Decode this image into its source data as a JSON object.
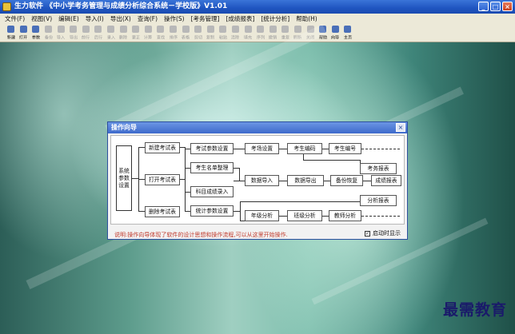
{
  "window": {
    "title": "生力软件 《中小学考务管理与成绩分析综合系统－学校版》V1.01",
    "controls": {
      "minimize": "_",
      "maximize": "□",
      "close": "×"
    }
  },
  "menu": {
    "items": [
      "文件(F)",
      "视图(V)",
      "编辑(E)",
      "导入(I)",
      "导出(X)",
      "查询(F)",
      "操作(S)",
      "[考务管理]",
      "[成绩报表]",
      "[统计分析]",
      "帮助(H)"
    ]
  },
  "toolbar": {
    "buttons": [
      {
        "label": "新建",
        "enabled": true
      },
      {
        "label": "打开",
        "enabled": true
      },
      {
        "label": "参数",
        "enabled": true
      },
      {
        "label": "备份",
        "enabled": false
      },
      {
        "label": "导入",
        "enabled": false
      },
      {
        "label": "导出",
        "enabled": false
      },
      {
        "label": "前行",
        "enabled": false
      },
      {
        "label": "后行",
        "enabled": false
      },
      {
        "label": "录入",
        "enabled": false
      },
      {
        "label": "删除",
        "enabled": false
      },
      {
        "label": "更正",
        "enabled": false
      },
      {
        "label": "计算",
        "enabled": false
      },
      {
        "label": "查找",
        "enabled": false
      },
      {
        "label": "排序",
        "enabled": false
      },
      {
        "label": "表格",
        "enabled": false
      },
      {
        "label": "剪切",
        "enabled": false
      },
      {
        "label": "复制",
        "enabled": false
      },
      {
        "label": "粘贴",
        "enabled": false
      },
      {
        "label": "清除",
        "enabled": false
      },
      {
        "label": "填充",
        "enabled": false
      },
      {
        "label": "序列",
        "enabled": false
      },
      {
        "label": "撤销",
        "enabled": false
      },
      {
        "label": "重复",
        "enabled": false
      },
      {
        "label": "刷新",
        "enabled": false
      },
      {
        "label": "关闭",
        "enabled": false
      },
      {
        "label": "帮助",
        "enabled": true
      },
      {
        "label": "向导",
        "enabled": true
      },
      {
        "label": "主页",
        "enabled": true
      }
    ]
  },
  "dialog": {
    "title": "操作向导",
    "close": "×",
    "root": "系统参数设置",
    "col1": {
      "new_exam": "新建考试表",
      "open_exam": "打开考试表",
      "delete_exam": "删除考试表"
    },
    "col2": {
      "exam_params": "考试参数设置",
      "student_list": "考生名单整理",
      "score_entry": "科目成绩录入",
      "stat_params": "统计参数设置"
    },
    "row1": {
      "room": "考场设置",
      "number": "考生编码",
      "id": "考生编号",
      "report": "考务报表"
    },
    "row2": {
      "import": "数据导入",
      "export": "数据导出",
      "backup": "备份恢复",
      "score_report": "成绩报表"
    },
    "row3": {
      "analysis_report": "分析报表",
      "grade": "年级分析",
      "class": "班级分析",
      "teacher": "教师分析"
    },
    "footer_text": "说明:操作向导体现了软件的设计思想和操作流程,可以从这里开始操作.",
    "startup_label": "启动时显示",
    "startup_checked": true
  },
  "watermark": "最需教育",
  "colors": {
    "titlebar": "#1f55c0",
    "footer_text": "#c0392b",
    "menubar": "#ece9d8"
  }
}
